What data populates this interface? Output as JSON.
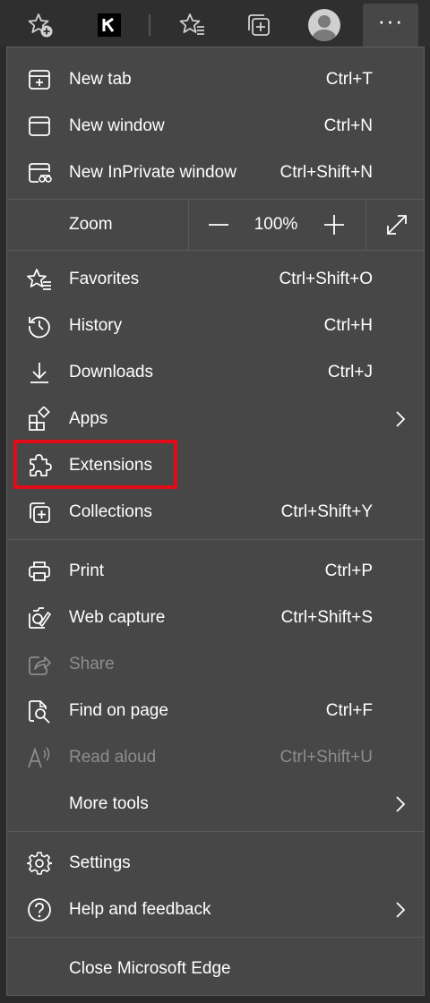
{
  "toolbar": {
    "items": [
      {
        "name": "favorites-add-icon"
      },
      {
        "name": "k-extension-icon",
        "label": "K"
      },
      {
        "name": "favorites-icon"
      },
      {
        "name": "collections-icon"
      },
      {
        "name": "profile-avatar-icon"
      },
      {
        "name": "more-options-icon",
        "label": "···"
      }
    ]
  },
  "menu": {
    "new_tab": {
      "label": "New tab",
      "shortcut": "Ctrl+T"
    },
    "new_window": {
      "label": "New window",
      "shortcut": "Ctrl+N"
    },
    "new_inprivate": {
      "label": "New InPrivate window",
      "shortcut": "Ctrl+Shift+N"
    },
    "zoom": {
      "label": "Zoom",
      "value": "100%"
    },
    "favorites": {
      "label": "Favorites",
      "shortcut": "Ctrl+Shift+O"
    },
    "history": {
      "label": "History",
      "shortcut": "Ctrl+H"
    },
    "downloads": {
      "label": "Downloads",
      "shortcut": "Ctrl+J"
    },
    "apps": {
      "label": "Apps"
    },
    "extensions": {
      "label": "Extensions"
    },
    "collections": {
      "label": "Collections",
      "shortcut": "Ctrl+Shift+Y"
    },
    "print": {
      "label": "Print",
      "shortcut": "Ctrl+P"
    },
    "web_capture": {
      "label": "Web capture",
      "shortcut": "Ctrl+Shift+S"
    },
    "share": {
      "label": "Share"
    },
    "find_on_page": {
      "label": "Find on page",
      "shortcut": "Ctrl+F"
    },
    "read_aloud": {
      "label": "Read aloud",
      "shortcut": "Ctrl+Shift+U"
    },
    "more_tools": {
      "label": "More tools"
    },
    "settings": {
      "label": "Settings"
    },
    "help_feedback": {
      "label": "Help and feedback"
    },
    "close_edge": {
      "label": "Close Microsoft Edge"
    }
  },
  "colors": {
    "menu_bg": "#474747",
    "toolbar_bg": "#2f2f2f",
    "highlight": "#e30b17",
    "disabled_text": "#8d8d8d"
  }
}
